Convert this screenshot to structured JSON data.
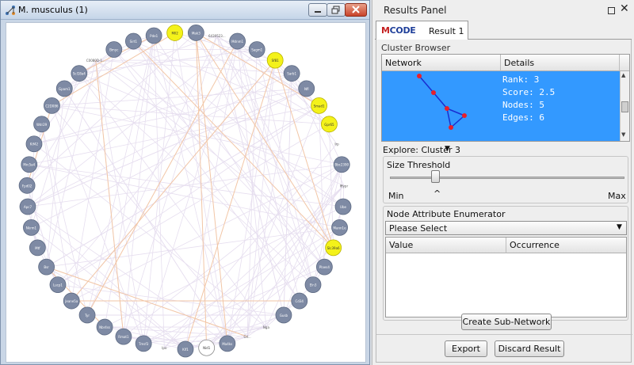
{
  "network_window": {
    "title": "M. musculus (1)",
    "nodes_left": [
      "Mll2",
      "Pde1",
      "Sirt1",
      "Bmyc",
      "C0080D-1...",
      "Scl18a4",
      "Gpam1",
      "C2D086",
      "Wdr29",
      "Kif42",
      "Mrc5a4",
      "Fpd02",
      "Apc7",
      "Nkrm1",
      "Mtf",
      "Bsr",
      "Lucp1",
      "Jeane5a",
      "Tyr",
      "Nbr4ss",
      "Rmat1",
      "Tmsf3",
      "Ipo"
    ],
    "nodes_right": [
      "Mak3",
      "6430523...",
      "Mdnm1",
      "Sagm1",
      "Sf81",
      "Sarb1",
      "Nfl",
      "Smad1",
      "Gpr65",
      "Irp",
      "Bbc2390",
      "Iffypr",
      "Ube",
      "Mann1e",
      "Slc39a6",
      "Plaes4",
      "Eln3",
      "Cd34",
      "Gusb",
      "Nga",
      "Cd...",
      "Ma4ks",
      "Nid1",
      "Klf1"
    ],
    "colors": {
      "node_gray": "#7e8aa4",
      "node_yellow": "#f4f21a",
      "edge_faint": "#e6deef",
      "edge_orange": "#f2c6a6"
    }
  },
  "results_panel": {
    "title": "Results Panel",
    "tab": {
      "logo_m": "M",
      "logo_rest": "CODE",
      "label": "Result 1"
    },
    "cluster_browser": {
      "title": "Cluster Browser",
      "columns": [
        "Network",
        "Details"
      ],
      "row": {
        "rank": "Rank: 3",
        "score": "Score: 2.5",
        "nodes": "Nodes: 5",
        "edges": "Edges: 6"
      }
    },
    "explore": {
      "label": "Explore: Cluster 3"
    },
    "size_threshold": {
      "label": "Size Threshold",
      "min_label": "Min",
      "max_label": "Max",
      "caret": "^",
      "level": 0.2
    },
    "enumerator": {
      "title": "Node Attribute Enumerator",
      "select_value": "Please Select",
      "columns": [
        "Value",
        "Occurrence"
      ]
    },
    "buttons": {
      "create_subnetwork": "Create Sub-Network",
      "export": "Export",
      "discard": "Discard Result"
    },
    "colors": {
      "selection_blue": "#3399ff",
      "cluster_node": "#e8202a",
      "cluster_edge": "#1a2fd0"
    }
  }
}
